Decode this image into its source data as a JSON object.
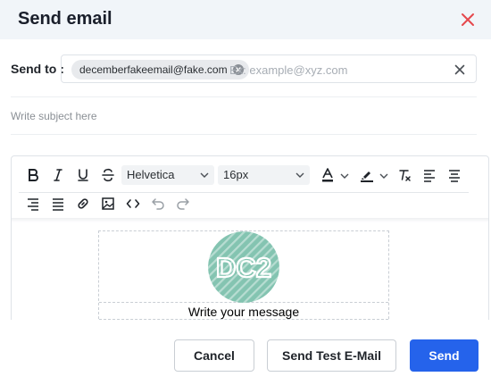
{
  "modal": {
    "title": "Send email",
    "close_icon": "close-icon",
    "accent_color": "#e5484d"
  },
  "recipient": {
    "label": "Send to :",
    "chips": [
      {
        "email": "decemberfakeemail@fake.com"
      }
    ],
    "placeholder": "Ex: example@xyz.com",
    "value": ""
  },
  "subject": {
    "placeholder": "Write subject here",
    "value": ""
  },
  "toolbar": {
    "font_family": "Helvetica",
    "font_size": "16px",
    "row1_icons": [
      "bold-icon",
      "italic-icon",
      "underline-icon",
      "strikethrough-icon",
      "font-color-icon",
      "highlight-icon",
      "clear-format-icon",
      "align-left-icon",
      "align-center-icon"
    ],
    "row2_icons": [
      "align-right-icon",
      "justify-icon",
      "link-icon",
      "image-icon",
      "code-icon",
      "undo-icon",
      "redo-icon"
    ]
  },
  "editor": {
    "logo_text": "DC2",
    "logo_color": "#84c4b1",
    "message_placeholder": "Write your message"
  },
  "footer": {
    "cancel_label": "Cancel",
    "test_label": "Send Test E-Mail",
    "send_label": "Send",
    "primary_color": "#2563eb"
  }
}
